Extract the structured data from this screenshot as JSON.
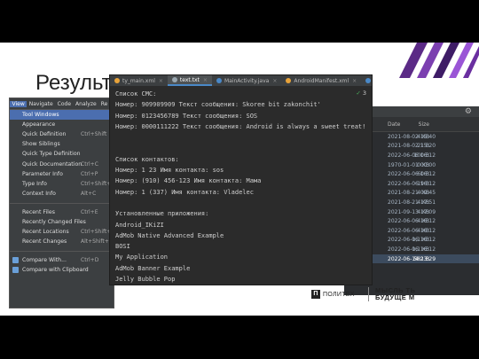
{
  "slide": {
    "title": "Результ"
  },
  "editor": {
    "tabs": [
      {
        "label": "ty_main.xml",
        "color": "#e8a33a"
      },
      {
        "label": "text.txt",
        "color": "#9aa7b0",
        "active": true
      },
      {
        "label": "MainActivity.java",
        "color": "#4a88c7"
      },
      {
        "label": "AndroidManifest.xml",
        "color": "#e8a33a"
      },
      {
        "label": "Payload.j",
        "color": "#4a88c7"
      }
    ],
    "close_glyph": "×",
    "badge": {
      "check": "✓",
      "count": "3"
    },
    "lines": [
      "Список СМС:",
      "Номер: 909909909 Текст сообщения: Skoree bit zakonchit'",
      "Номер: 0123456789 Текст сообщения: SOS",
      "Номер: 0000111222 Текст сообщения: Android is always a sweet treat!",
      "",
      "",
      "Список контактов:",
      "Номер: 1 23 Имя контакта: sos",
      "Номер: (910) 456-123 Имя контакта: Мама",
      "Номер: 1 (337) Имя контакта: Vladelec",
      "",
      "Установленные приложения:",
      "Android_IKiZI",
      "AdMob Native Advanced Example",
      "BOSI",
      "My Application",
      "AdMob Banner Example",
      "Jelly Bubble Pop"
    ]
  },
  "menu": {
    "bar": [
      "View",
      "Navigate",
      "Code",
      "Analyze",
      "Re"
    ],
    "items": [
      {
        "label": "Tool Windows",
        "shortcut": "",
        "highlight": true
      },
      {
        "label": "Appearance",
        "shortcut": ""
      },
      {
        "label": "Quick Definition",
        "shortcut": "Ctrl+Shift"
      },
      {
        "label": "Show Siblings",
        "shortcut": ""
      },
      {
        "label": "Quick Type Definition",
        "shortcut": ""
      },
      {
        "label": "Quick Documentation",
        "shortcut": "Ctrl+C"
      },
      {
        "label": "Parameter Info",
        "shortcut": "Ctrl+P"
      },
      {
        "label": "Type Info",
        "shortcut": "Ctrl+Shift+P"
      },
      {
        "label": "Context Info",
        "shortcut": "Alt+C"
      },
      {
        "sep": true
      },
      {
        "label": "Recent Files",
        "shortcut": "Ctrl+E"
      },
      {
        "label": "Recently Changed Files",
        "shortcut": ""
      },
      {
        "label": "Recent Locations",
        "shortcut": "Ctrl+Shift+E"
      },
      {
        "label": "Recent Changes",
        "shortcut": "Alt+Shift+C"
      },
      {
        "sep": true
      },
      {
        "label": "Compare With...",
        "shortcut": "Ctrl+D",
        "icon": true
      },
      {
        "label": "Compare with Clipboard",
        "shortcut": "",
        "icon": true
      }
    ]
  },
  "files": {
    "gear": "⚙",
    "headers": {
      "date": "Date",
      "size": "Size"
    },
    "rows": [
      {
        "date": "2021-08-02 15:40",
        "size": "4 KB"
      },
      {
        "date": "2021-08-02 15:20",
        "size": "21 B"
      },
      {
        "date": "2022-06-06 16:12",
        "size": "100 B"
      },
      {
        "date": "1970-01-01 00:00",
        "size": "0 KB"
      },
      {
        "date": "2022-06-06 16:12",
        "size": "60 B"
      },
      {
        "date": "2022-06-06 16:12",
        "size": "19 B"
      },
      {
        "date": "2021-08-21 09:45",
        "size": "4 KB"
      },
      {
        "date": "2021-08-21 17:51",
        "size": "4 KB"
      },
      {
        "date": "2021-09-13 17:09",
        "size": "4 KB"
      },
      {
        "date": "2022-06-06 16:12",
        "size": "4 KB"
      },
      {
        "date": "2022-06-06 16:12",
        "size": "4 KB"
      },
      {
        "date": "2022-06-06 16:12",
        "size": "1,1 KB"
      },
      {
        "date": "2022-06-06 16:12",
        "size": "1,1 KB"
      },
      {
        "date": "2022-06-14 23:29",
        "size": "581 B",
        "selected": true
      }
    ]
  },
  "footer": {
    "logo1_mark": "П",
    "logo1_text": "ПОЛИТЕХ",
    "logo2_line1": "МЫСЛЬ ТЬ",
    "logo2_line2": "БУДУЩЕ М"
  }
}
